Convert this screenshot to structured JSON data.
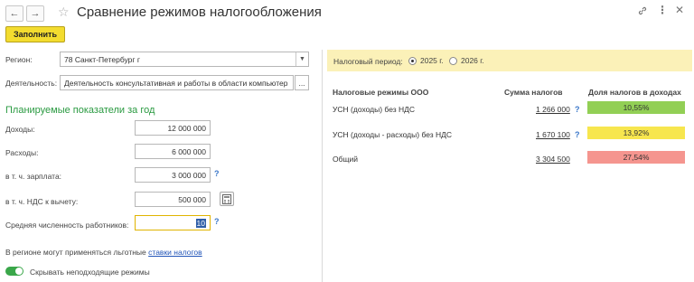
{
  "header": {
    "title": "Сравнение режимов налогообложения",
    "back_icon": "arrow-left-icon",
    "forward_icon": "arrow-right-icon",
    "star_icon": "star-icon"
  },
  "toolbar": {
    "fill_label": "Заполнить"
  },
  "left": {
    "region_label": "Регион:",
    "region_value": "78 Санкт-Петербург г",
    "activity_label": "Деятельность:",
    "activity_value": "Деятельность консультативная и работы в области компьютер",
    "section_title": "Планируемые показатели за год",
    "income_label": "Доходы:",
    "income_value": "12 000 000",
    "expenses_label": "Расходы:",
    "expenses_value": "6 000 000",
    "salary_label": "в т. ч. зарплата:",
    "salary_value": "3 000 000",
    "vat_label": "в т. ч. НДС к вычету:",
    "vat_value": "500 000",
    "staff_label": "Средняя численность работников:",
    "staff_value": "10",
    "note_text": "В регионе могут применяться льготные",
    "note_link": "ставки налогов",
    "toggle_label": "Скрывать неподходящие режимы",
    "ellipsis": "...",
    "help": "?"
  },
  "right": {
    "period_label": "Налоговый период:",
    "period_options": [
      "2025 г.",
      "2026 г."
    ],
    "period_selected": "2025 г.",
    "table": {
      "headers": [
        "Налоговые режимы ООО",
        "Сумма налогов",
        "Доля налогов в доходах"
      ],
      "rows": [
        {
          "regime": "УСН (доходы) без НДС",
          "sum": "1 266 000",
          "help": "?",
          "share": "10,55%",
          "color": "#92cf55"
        },
        {
          "regime": "УСН (доходы - расходы) без НДС",
          "sum": "1 670 100",
          "help": "?",
          "share": "13,92%",
          "color": "#f7e64e"
        },
        {
          "regime": "Общий",
          "sum": "3 304 500",
          "help": "",
          "share": "27,54%",
          "color": "#f5958f"
        }
      ]
    }
  },
  "colors": {
    "accent_yellow": "#f3dc2f",
    "section_green": "#2a9a41",
    "link_blue": "#2255b8"
  }
}
